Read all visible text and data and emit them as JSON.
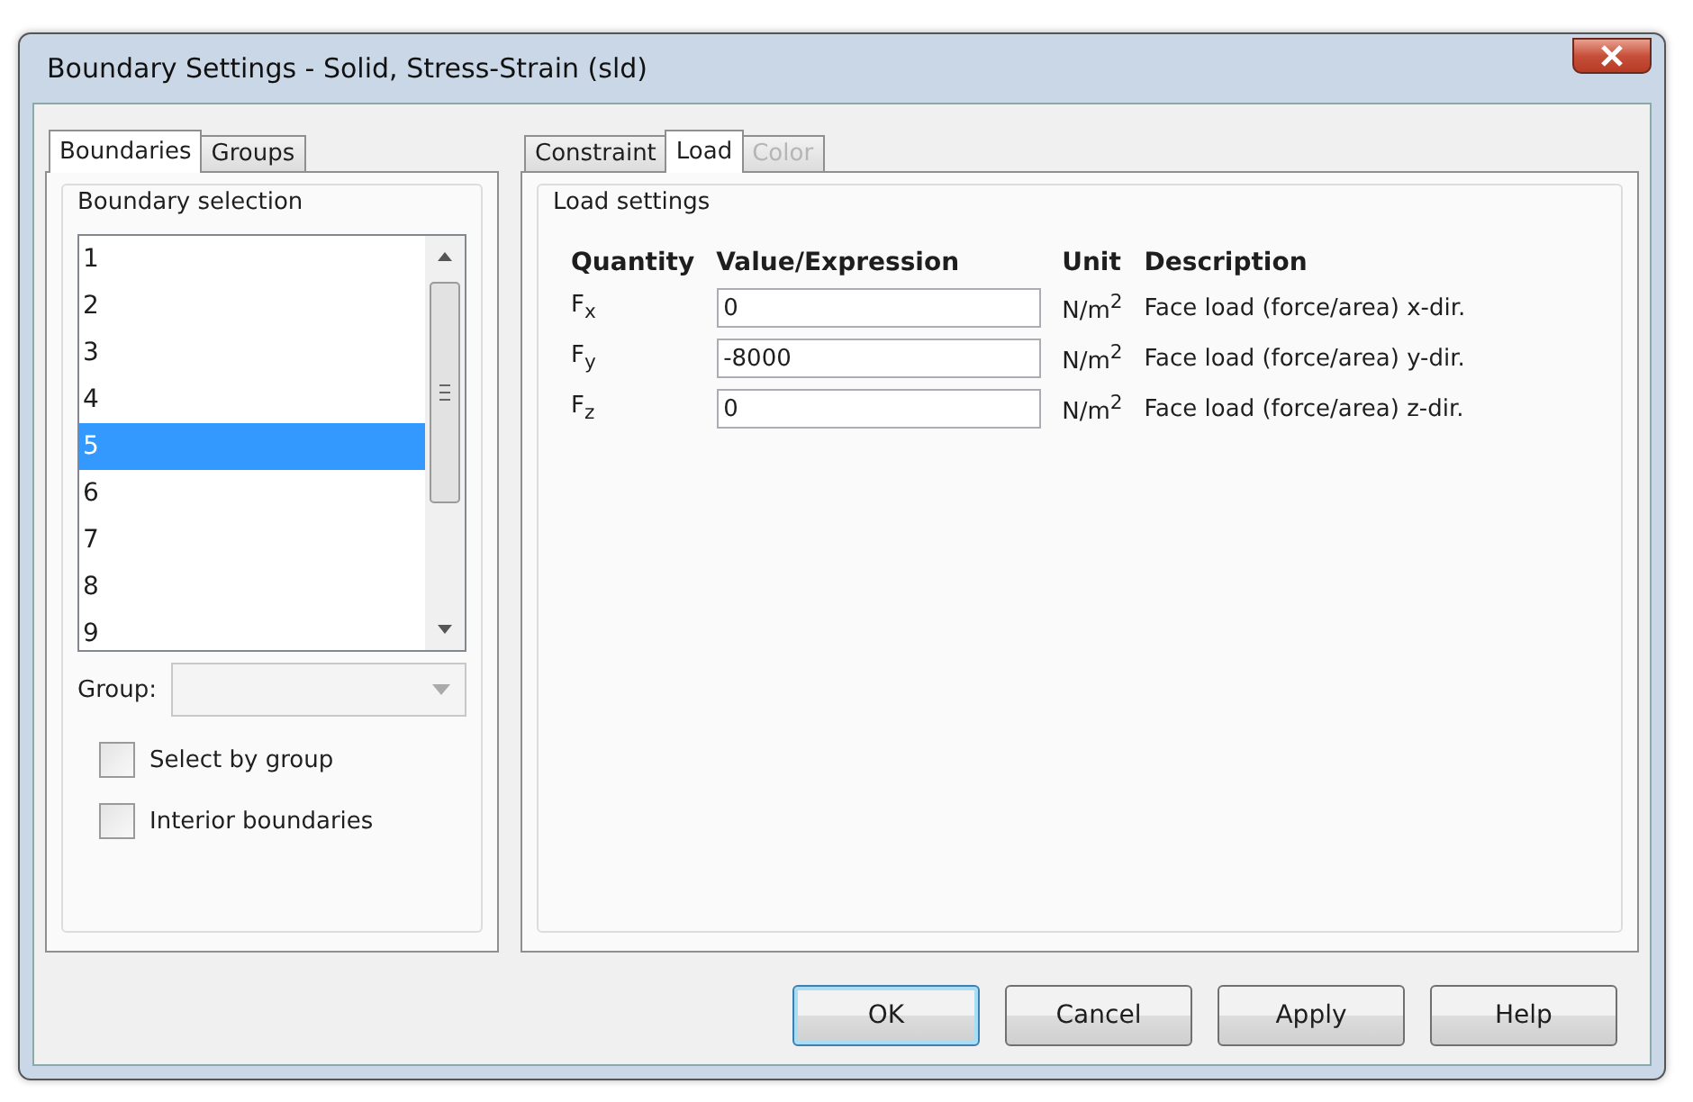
{
  "window": {
    "title": "Boundary Settings - Solid, Stress-Strain (sld)"
  },
  "left_tabs": [
    {
      "label": "Boundaries",
      "selected": true
    },
    {
      "label": "Groups",
      "selected": false
    }
  ],
  "boundary_selection": {
    "title": "Boundary selection",
    "items": [
      {
        "label": "1",
        "selected": false
      },
      {
        "label": "2",
        "selected": false
      },
      {
        "label": "3",
        "selected": false
      },
      {
        "label": "4",
        "selected": false
      },
      {
        "label": "5",
        "selected": true
      },
      {
        "label": "6",
        "selected": false
      },
      {
        "label": "7",
        "selected": false
      },
      {
        "label": "8",
        "selected": false
      },
      {
        "label": "9",
        "selected": false
      }
    ],
    "group_dropdown": {
      "label": "Group:",
      "disabled": true
    },
    "checkboxes": [
      {
        "label": "Select by group",
        "checked": false
      },
      {
        "label": "Interior boundaries",
        "checked": false
      }
    ]
  },
  "right_tabs": [
    {
      "label": "Constraint",
      "selected": false,
      "disabled": false
    },
    {
      "label": "Load",
      "selected": true,
      "disabled": false
    },
    {
      "label": "Color",
      "selected": false,
      "disabled": true
    }
  ],
  "load_settings": {
    "title": "Load settings",
    "columns": [
      "Quantity",
      "Value/Expression",
      "Unit",
      "Description"
    ],
    "rows": [
      {
        "quantity": "F$_{x}$",
        "value": "0",
        "unit": "N/m$^{2}$",
        "description": "Face load (force/area) x-dir."
      },
      {
        "quantity": "F$_{y}$",
        "value": "-8000",
        "unit": "N/m$^{2}$",
        "description": "Face load (force/area) y-dir."
      },
      {
        "quantity": "F$_{z}$",
        "value": "0",
        "unit": "N/m$^{2}$",
        "description": "Face load (force/area) z-dir."
      }
    ]
  },
  "buttons": [
    {
      "label": "OK",
      "default": true
    },
    {
      "label": "Cancel",
      "default": false
    },
    {
      "label": "Apply",
      "default": false
    },
    {
      "label": "Help",
      "default": false
    }
  ]
}
